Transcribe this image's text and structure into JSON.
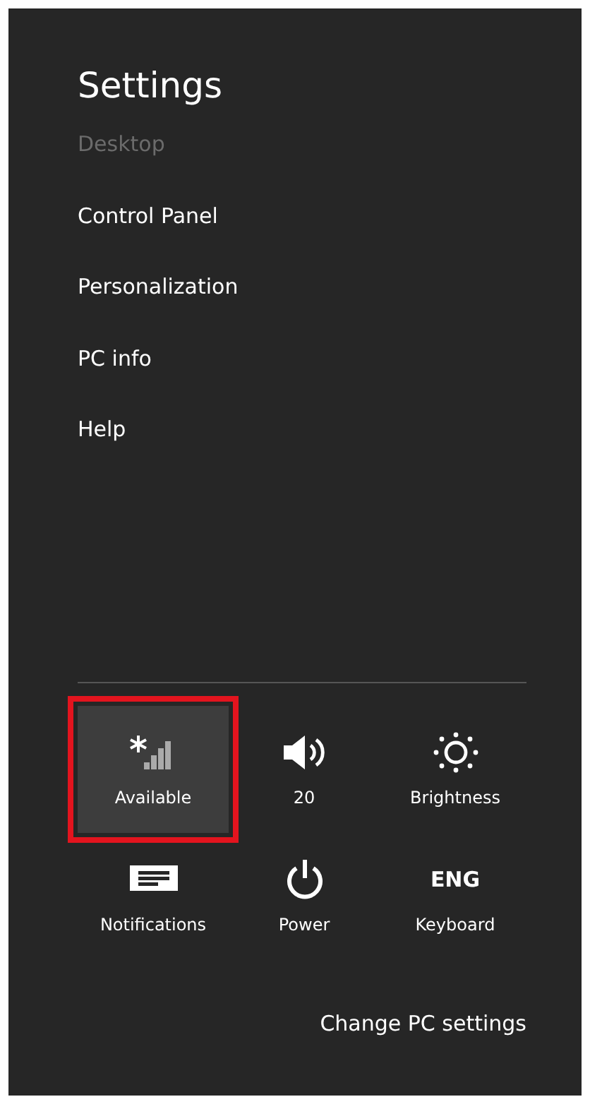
{
  "title": "Settings",
  "items": [
    {
      "label": "Desktop",
      "disabled": true
    },
    {
      "label": "Control Panel",
      "disabled": false
    },
    {
      "label": "Personalization",
      "disabled": false
    },
    {
      "label": "PC info",
      "disabled": false
    },
    {
      "label": "Help",
      "disabled": false
    }
  ],
  "tiles": [
    {
      "kind": "signal",
      "label": "Available",
      "selected": true,
      "highlighted": true
    },
    {
      "kind": "volume",
      "label": "20",
      "selected": false,
      "highlighted": false
    },
    {
      "kind": "brightness",
      "label": "Brightness",
      "selected": false,
      "highlighted": false
    },
    {
      "kind": "notifications",
      "label": "Notifications",
      "selected": false,
      "highlighted": false
    },
    {
      "kind": "power",
      "label": "Power",
      "selected": false,
      "highlighted": false
    },
    {
      "kind": "text",
      "glyph": "ENG",
      "label": "Keyboard",
      "selected": false,
      "highlighted": false
    }
  ],
  "footer_link": "Change PC settings"
}
